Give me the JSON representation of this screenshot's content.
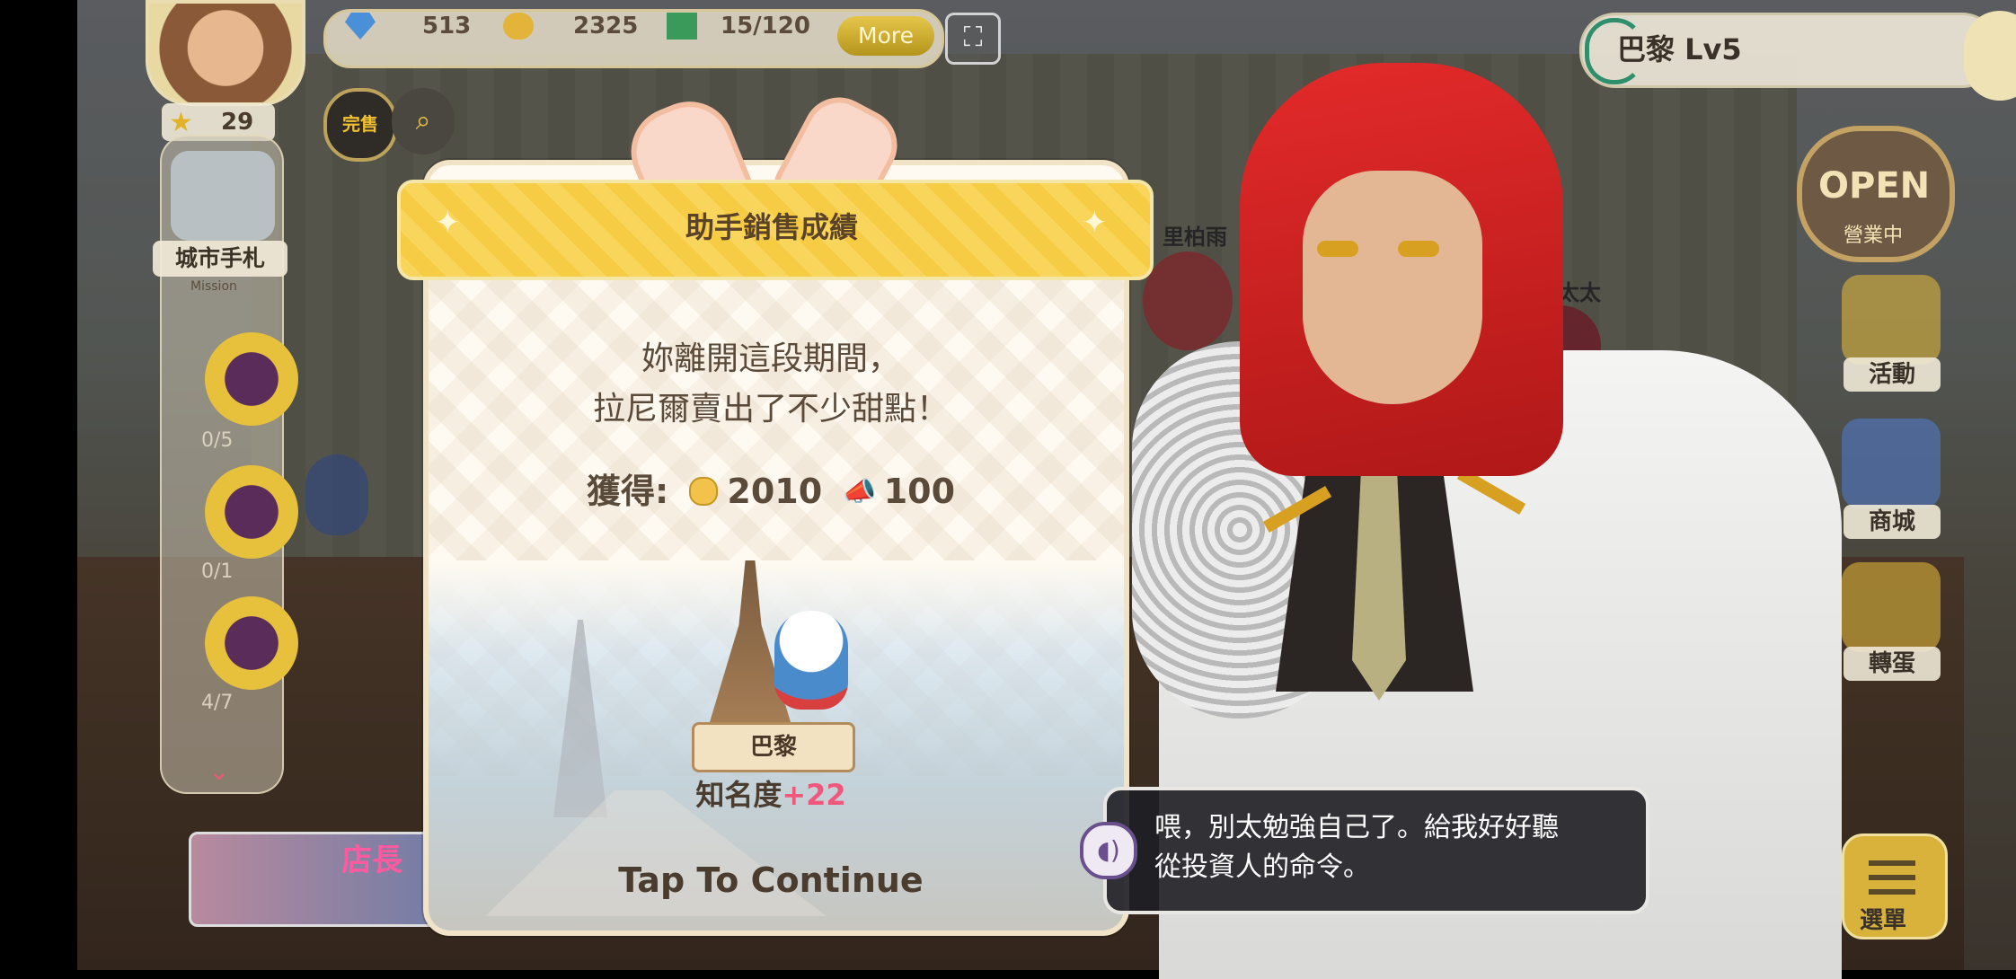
{
  "topbar": {
    "gems": "513",
    "coins": "2325",
    "tickets": "15/120",
    "more_label": "More"
  },
  "left_panel": {
    "level": "29",
    "city_book_label": "城市手札",
    "mission_label": "Mission",
    "missions": [
      {
        "count": "0/5"
      },
      {
        "count": "0/1"
      },
      {
        "count": "4/7"
      }
    ],
    "sale_label": "完售",
    "banner_text": "店長"
  },
  "right_panel": {
    "city_name": "巴黎 Lv5",
    "open_sign": "OPEN",
    "open_sub": "營業中",
    "activity_label": "活動",
    "shop_label": "商城",
    "gacha_label": "轉蛋",
    "menu_label": "選單"
  },
  "dialog": {
    "title": "助手銷售成績",
    "line1": "妳離開這段期間，",
    "line2": "拉尼爾賣出了不少甜點！",
    "reward_label": "獲得:",
    "coin_reward": "2010",
    "fame_points_reward": "100",
    "city_name": "巴黎",
    "fame_label": "知名度",
    "fame_value": "+22",
    "continue_label": "Tap To Continue"
  },
  "npc_names": {
    "npc1": "里柏雨",
    "npc2": "老太太"
  },
  "speech": {
    "line1": "喂，別太勉強自己了。給我好好聽",
    "line2": "從投資人的命令。"
  },
  "colors": {
    "ribbon": "#f9d55c",
    "fame_accent": "#f0577c",
    "hair": "#e32a2a",
    "accent_gold": "#d8a021"
  }
}
